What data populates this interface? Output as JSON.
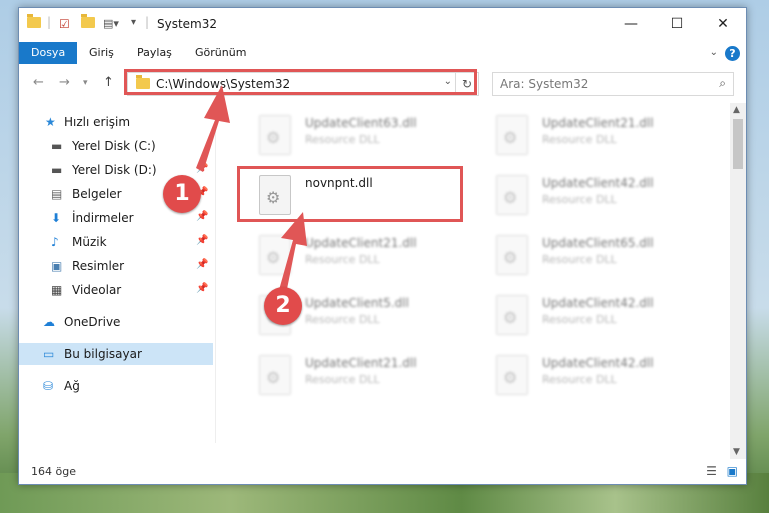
{
  "window": {
    "title": "System32",
    "controls": {
      "minimize": "—",
      "maximize": "☐",
      "close": "✕"
    }
  },
  "ribbon": {
    "tabs": [
      {
        "label": "Dosya"
      },
      {
        "label": "Giriş"
      },
      {
        "label": "Paylaş"
      },
      {
        "label": "Görünüm"
      }
    ],
    "help": "?"
  },
  "address": {
    "path": "C:\\Windows\\System32",
    "search_placeholder": "Ara: System32"
  },
  "nav": {
    "items": [
      {
        "label": "Hızlı erişim",
        "icon": "star-icon"
      },
      {
        "label": "Yerel Disk (C:)",
        "icon": "drive-icon"
      },
      {
        "label": "Yerel Disk (D:)",
        "icon": "drive-icon"
      },
      {
        "label": "Belgeler",
        "icon": "documents-icon"
      },
      {
        "label": "İndirmeler",
        "icon": "download-icon"
      },
      {
        "label": "Müzik",
        "icon": "music-icon"
      },
      {
        "label": "Resimler",
        "icon": "pictures-icon"
      },
      {
        "label": "Videolar",
        "icon": "video-icon"
      },
      {
        "label": "OneDrive",
        "icon": "cloud-icon"
      },
      {
        "label": "Bu bilgisayar",
        "icon": "computer-icon"
      },
      {
        "label": "Ağ",
        "icon": "network-icon"
      }
    ]
  },
  "files": {
    "left": [
      {
        "name": "UpdateClient63.dll",
        "type": "Resource DLL"
      },
      {
        "name": "novnpnt.dll",
        "type": ""
      },
      {
        "name": "UpdateClient21.dll",
        "type": "Resource DLL"
      },
      {
        "name": "UpdateClient5.dll",
        "type": "Resource DLL"
      },
      {
        "name": "UpdateClient21.dll",
        "type": "Resource DLL"
      }
    ],
    "right": [
      {
        "name": "UpdateClient21.dll",
        "type": "Resource DLL"
      },
      {
        "name": "UpdateClient42.dll",
        "type": "Resource DLL"
      },
      {
        "name": "UpdateClient65.dll",
        "type": "Resource DLL"
      },
      {
        "name": "UpdateClient42.dll",
        "type": "Resource DLL"
      },
      {
        "name": "UpdateClient42.dll",
        "type": "Resource DLL"
      }
    ]
  },
  "status": {
    "count": "164 öge"
  },
  "annotations": {
    "step1": "1",
    "step2": "2",
    "color": "#e05656"
  }
}
